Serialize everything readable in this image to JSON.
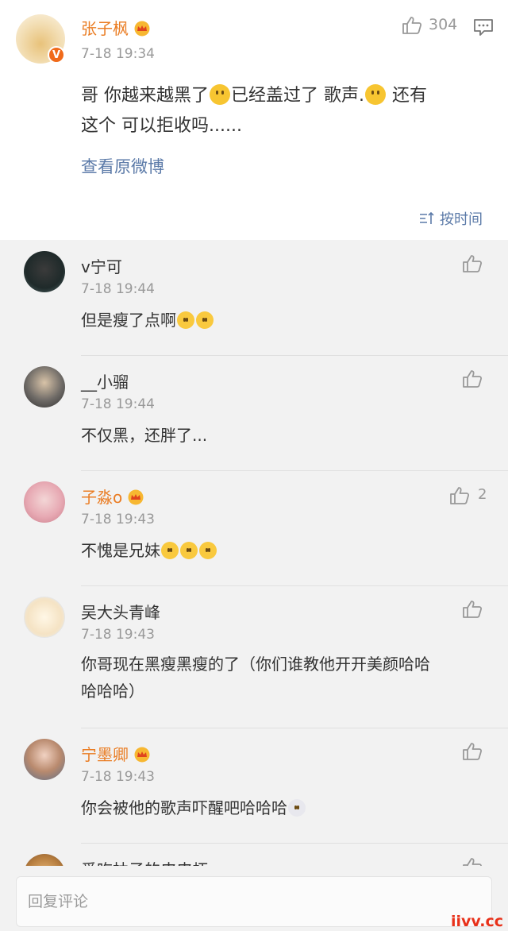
{
  "post": {
    "username": "张子枫",
    "verified_badge": "V",
    "time": "7-18 19:34",
    "likes": "304",
    "text_line1_a": "哥 你越来越黑了",
    "text_line1_b": "已经盖过了 歌声.",
    "text_line1_c": " 还有",
    "text_line2": "这个 可以拒收吗......",
    "view_original": "查看原微博",
    "sort_label": "按时间"
  },
  "comments": [
    {
      "username": "v宁可",
      "time": "7-18 19:44",
      "text": "但是瘦了点啊",
      "likes": "",
      "vip": false
    },
    {
      "username": "__小骝",
      "time": "7-18 19:44",
      "text": "不仅黑，还胖了...",
      "likes": "",
      "vip": false
    },
    {
      "username": "子淼o",
      "time": "7-18 19:43",
      "text": "不愧是兄妹",
      "likes": "2",
      "vip": true
    },
    {
      "username": "吴大头青峰",
      "time": "7-18 19:43",
      "text_line1": "你哥现在黑瘦黑瘦的了（你们谁教他开开美颜哈哈",
      "text_line2": "哈哈哈）",
      "likes": "",
      "vip": false
    },
    {
      "username": "宁墨卿",
      "time": "7-18 19:43",
      "text": "你会被他的歌声吓醒吧哈哈哈",
      "likes": "",
      "vip": true
    },
    {
      "username": "爱吃柚子的皮皮虾",
      "time": "",
      "text": "",
      "likes": "",
      "vip": false
    }
  ],
  "reply": {
    "placeholder": "回复评论"
  },
  "watermark": "iivv.cc",
  "icons": {
    "like": "thumbs-up-icon",
    "comment": "comment-icon",
    "crown": "crown-icon",
    "sort": "sort-icon"
  },
  "colors": {
    "vip_name": "#ea7d24",
    "link": "#5b7aa8",
    "watermark": "#e8311a"
  }
}
